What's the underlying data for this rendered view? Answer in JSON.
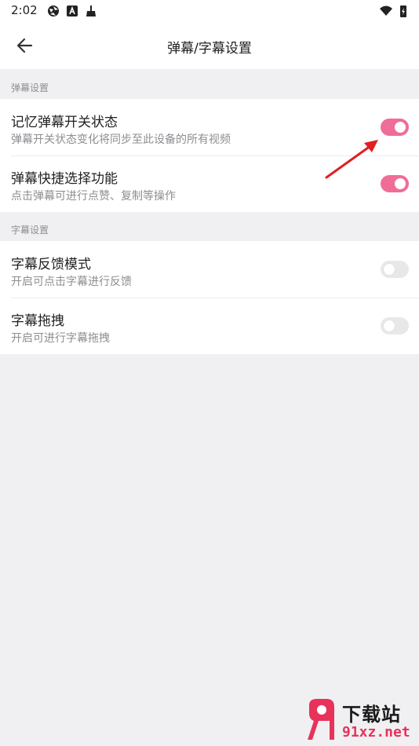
{
  "status_bar": {
    "time": "2:02",
    "left_icons": [
      "aperture-icon",
      "font-a-icon",
      "broom-icon"
    ],
    "right_icons": [
      "wifi-icon",
      "battery-charging-icon"
    ]
  },
  "header": {
    "title": "弹幕/字幕设置",
    "back_icon": "arrow-left-icon"
  },
  "sections": [
    {
      "title": "弹幕设置",
      "items": [
        {
          "title": "记忆弹幕开关状态",
          "subtitle": "弹幕开关状态变化将同步至此设备的所有视频",
          "enabled": true
        },
        {
          "title": "弹幕快捷选择功能",
          "subtitle": "点击弹幕可进行点赞、复制等操作",
          "enabled": true
        }
      ]
    },
    {
      "title": "字幕设置",
      "items": [
        {
          "title": "字幕反馈模式",
          "subtitle": "开启可点击字幕进行反馈",
          "enabled": false
        },
        {
          "title": "字幕拖拽",
          "subtitle": "开启可进行字幕拖拽",
          "enabled": false
        }
      ]
    }
  ],
  "colors": {
    "switch_on": "#f06d97",
    "switch_off": "#e8e8ea",
    "page_background": "#f0f0f3",
    "annotation_arrow": "#e0201f"
  },
  "watermark": {
    "title": "下载站",
    "domain": "91xz.net"
  }
}
